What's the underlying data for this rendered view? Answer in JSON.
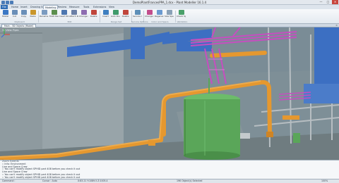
{
  "window": {
    "title": "DemoPlantFrancesPPA_1.dcx - Plant Modeller 16.1.4",
    "controls": [
      "—",
      "□",
      "✕"
    ]
  },
  "tabs": [
    {
      "label": "File"
    },
    {
      "label": "Home"
    },
    {
      "label": "Insert"
    },
    {
      "label": "Drawing Set"
    },
    {
      "label": "Modeling"
    },
    {
      "label": "Review"
    },
    {
      "label": "Measure"
    },
    {
      "label": "Tools"
    },
    {
      "label": "Extensions"
    },
    {
      "label": "View"
    }
  ],
  "ribbon": {
    "buttons": [
      {
        "label": "Model",
        "color": "#3b78c4"
      },
      {
        "label": "Cut",
        "color": "#6a8fb8"
      },
      {
        "label": "Copy",
        "color": "#6a8fb8"
      },
      {
        "label": "Paste",
        "color": "#c9962b"
      },
      {
        "label": "Rename Objects",
        "color": "#7b9bc0"
      },
      {
        "label": "Multi Resize",
        "color": "#5c8f4e"
      },
      {
        "label": "Insert Ribbon",
        "color": "#4d77b0"
      },
      {
        "label": "Attach Route",
        "color": "#6b7fa6"
      },
      {
        "label": "Change Orientation",
        "color": "#8d6cb0"
      },
      {
        "label": "Delete",
        "color": "#c0463c"
      },
      {
        "label": "Insert",
        "color": "#3f7fc0"
      },
      {
        "label": "Auto Route",
        "color": "#3f9b6b"
      },
      {
        "label": "Delete",
        "color": "#c0463c"
      },
      {
        "label": "Service Options",
        "color": "#5d8fb8"
      },
      {
        "label": "Change Color",
        "color": "#c24d8c"
      },
      {
        "label": "Regenerate From Size",
        "color": "#6a9ad0"
      },
      {
        "label": "Size Spec",
        "color": "#8aa1b7"
      },
      {
        "label": "Check Spec",
        "color": "#4aa06a"
      }
    ],
    "groups": [
      "Clipboard",
      "Edit",
      "Route",
      "Range Set",
      "Service Options",
      "Color and Specs",
      "Validation"
    ]
  },
  "document": {
    "tab_label": "Main - 3D Objects (Model)",
    "close_glyph": "×"
  },
  "viewport": {
    "label": "3D View: Pipes",
    "colors": {
      "concrete": "#9aa8ad",
      "wall": "#8b979c",
      "pipe_orange": "#e5982f",
      "pipe_magenta": "#c64ec0",
      "duct_blue": "#3c6fc2",
      "tank_green": "#5aa659",
      "steel_gray": "#b7bec2",
      "ground": "#6f7c80"
    }
  },
  "command_log": {
    "title": "Zoom Extents",
    "lines": [
      ":: Info: Environment",
      "Line and Space Crew",
      ":: You can't modify object SPHID part 408 before you check it out",
      "Line and Space Crew",
      ":: You can't modify object SPHID part 408 before you check it out",
      ":: You can't modify object SPHID part 408 before you check it out"
    ]
  },
  "status": {
    "left": "Command :",
    "mode": "Cursor : Auto",
    "coords": "X:83.21  Y:1089.5  Z:1005.4",
    "selection": "196 Object(s) Selected",
    "zoom": "100%"
  }
}
